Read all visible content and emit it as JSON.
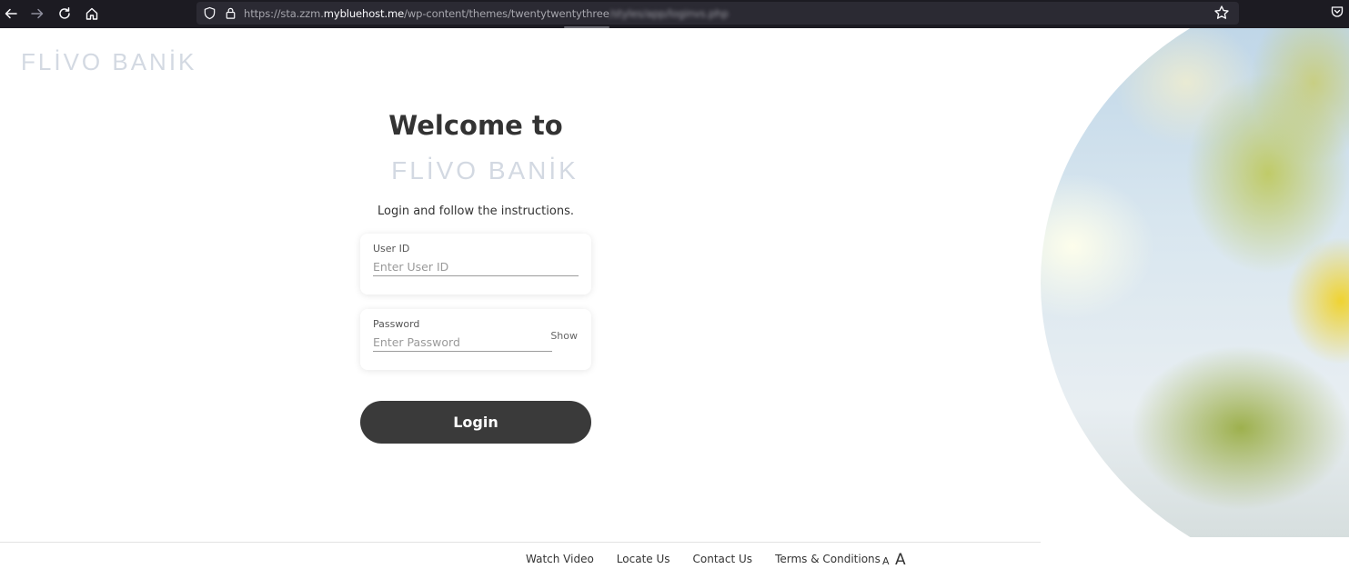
{
  "browser": {
    "url_prefix": "https://sta.zzm.",
    "url_host": "mybluehost.me",
    "url_path": "/wp-content/themes/twentytwentythree",
    "url_obscured": "/styles/app/loginvs.php"
  },
  "brand": {
    "logo_text": "FLİVO BANİK"
  },
  "login": {
    "welcome": "Welcome to",
    "logo_text": "FLİVO BANİK",
    "instructions": "Login and follow the instructions.",
    "user_id_label": "User ID",
    "user_id_placeholder": "Enter User ID",
    "password_label": "Password",
    "password_placeholder": "Enter Password",
    "show_label": "Show",
    "login_button": "Login"
  },
  "footer": {
    "links": [
      "Watch Video",
      "Locate Us",
      "Contact Us",
      "Terms & Conditions"
    ],
    "text_size_small": "A",
    "text_size_large": "A"
  }
}
